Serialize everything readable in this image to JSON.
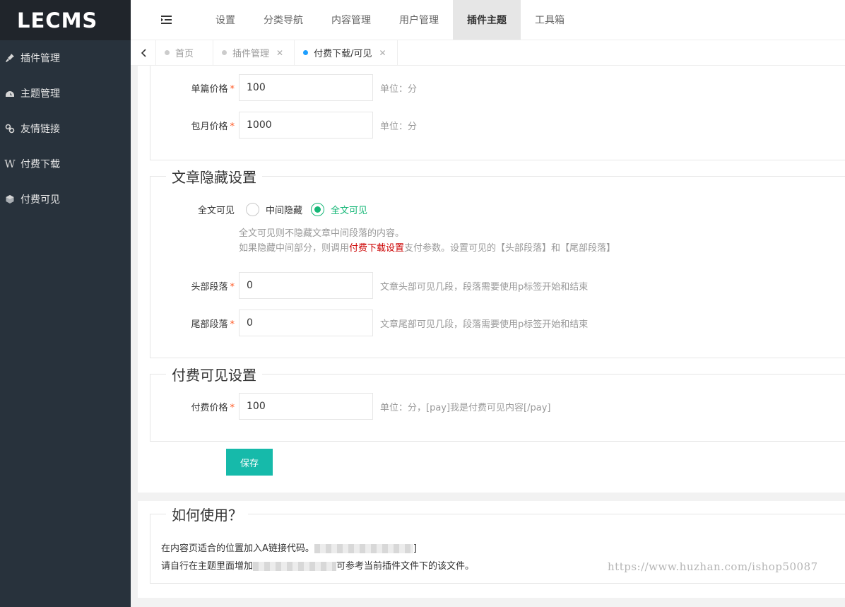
{
  "logo": "LECMS",
  "sidebar": {
    "items": [
      {
        "label": "插件管理",
        "icon": "plug-icon"
      },
      {
        "label": "主题管理",
        "icon": "dashboard-icon"
      },
      {
        "label": "友情链接",
        "icon": "link-icon"
      },
      {
        "label": "付费下载",
        "icon": "wordpress-icon"
      },
      {
        "label": "付费可见",
        "icon": "cube-icon"
      }
    ]
  },
  "topnav": {
    "toggle_icon": "menu-toggle-icon",
    "items": [
      "设置",
      "分类导航",
      "内容管理",
      "用户管理",
      "插件主题",
      "工具箱"
    ],
    "active": "插件主题"
  },
  "tabs": [
    {
      "label": "首页",
      "closable": false
    },
    {
      "label": "插件管理",
      "closable": true
    },
    {
      "label": "付费下载/可见",
      "closable": true,
      "active": true
    }
  ],
  "download": {
    "single_price_label": "单篇价格",
    "single_price_value": "100",
    "single_price_hint": "单位：分",
    "monthly_price_label": "包月价格",
    "monthly_price_value": "1000",
    "monthly_price_hint": "单位：分"
  },
  "hide": {
    "title": "文章隐藏设置",
    "fulltext_label": "全文可见",
    "option_middle": "中间隐藏",
    "option_full": "全文可见",
    "selected": "全文可见",
    "desc_line1": "全文可见则不隐藏文章中间段落的内容。",
    "desc_line2_a": "如果隐藏中间部分，则调用",
    "desc_line2_link": "付费下载设置",
    "desc_line2_b": "支付参数。设置可见的【头部段落】和【尾部段落】",
    "head_label": "头部段落",
    "head_value": "0",
    "head_hint": "文章头部可见几段，段落需要使用p标签开始和结束",
    "tail_label": "尾部段落",
    "tail_value": "0",
    "tail_hint": "文章尾部可见几段，段落需要使用p标签开始和结束"
  },
  "visible": {
    "title": "付费可见设置",
    "price_label": "付费价格",
    "price_value": "100",
    "price_hint": "单位：分，[pay]我是付费可见内容[/pay]"
  },
  "save_label": "保存",
  "usage": {
    "title": "如何使用？",
    "line1": "在内容页适合的位置加入A链接代码。",
    "line1_tail": "]",
    "line2": "请自行在主题里面增加",
    "line2_tail": "可参考当前插件文件下的该文件。"
  },
  "watermark": "https://www.huzhan.com/ishop50087",
  "colors": {
    "sidebar_bg": "#28323c",
    "accent_green": "#16b777",
    "button_teal": "#16baaa",
    "tab_active_dot": "#1e9fff",
    "required_star": "#ff5722"
  }
}
